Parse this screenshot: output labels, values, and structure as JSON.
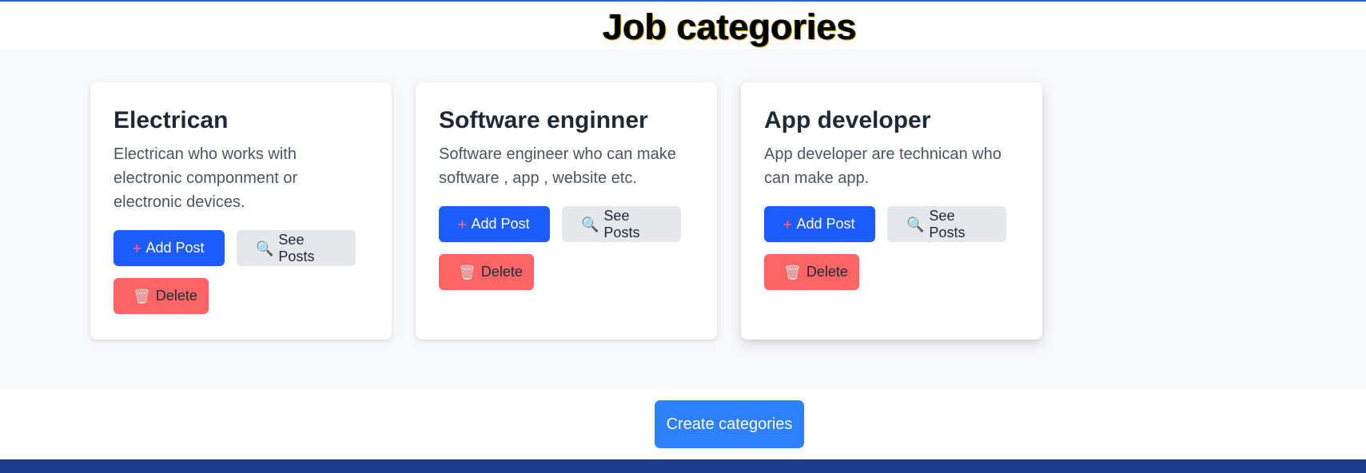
{
  "page": {
    "title": "Job categories"
  },
  "categories": [
    {
      "title": "Electrican",
      "description": "Electrican who works with electronic componment or electronic devices.",
      "add_label": "Add Post",
      "see_label": "See Posts",
      "delete_label": "Delete"
    },
    {
      "title": "Software enginner",
      "description": "Software engineer who can make software , app , website etc.",
      "add_label": "Add Post",
      "see_label": "See Posts",
      "delete_label": "Delete"
    },
    {
      "title": "App developer",
      "description": "App developer are technican who can make app.",
      "add_label": "Add Post",
      "see_label": "See Posts",
      "delete_label": "Delete"
    }
  ],
  "icons": {
    "add": "plus-icon",
    "see": "magnifier-icon",
    "delete": "trash-icon"
  },
  "actions": {
    "create_label": "Create categories"
  },
  "colors": {
    "accent": "#2563eb",
    "add_button": "#1d5cff",
    "see_button": "#e5e7eb",
    "delete_button": "#fd6466",
    "create_button": "#2f80fe",
    "footer": "#1e3a8a"
  }
}
